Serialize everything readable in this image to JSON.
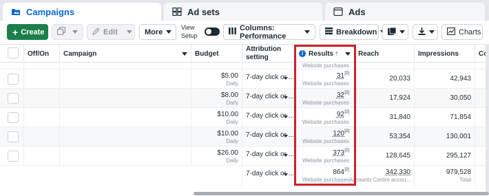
{
  "tabs": [
    {
      "label": "Campaigns",
      "icon": "folder-icon"
    },
    {
      "label": "Ad sets",
      "icon": "grid-icon"
    },
    {
      "label": "Ads",
      "icon": "ad-icon"
    }
  ],
  "toolbar": {
    "create": "Create",
    "edit": "Edit",
    "more": "More",
    "view_setup": "View Setup",
    "columns": "Columns: Performance",
    "breakdown": "Breakdown",
    "charts": "Charts"
  },
  "headers": {
    "off_on": "Off/On",
    "campaign": "Campaign",
    "budget": "Budget",
    "attribution": "Attribution setting",
    "results": "Results",
    "reach": "Reach",
    "impressions": "Impressions",
    "cost": "Co"
  },
  "rows": [
    {
      "budget": "$5.00",
      "period": "Daily",
      "attribution": "7-day click or ...",
      "results": "31",
      "results_sub": "Website purchases",
      "reach": "20,033",
      "impressions": "42,943"
    },
    {
      "budget": "$8.00",
      "period": "Daily",
      "attribution": "7-day click or ...",
      "results": "32",
      "results_sub": "Website purchases",
      "reach": "17,924",
      "impressions": "30,050"
    },
    {
      "budget": "$10.00",
      "period": "Daily",
      "attribution": "7-day click or ...",
      "results": "92",
      "results_sub": "Website purchases",
      "reach": "31,840",
      "impressions": "71,854"
    },
    {
      "budget": "$10.00",
      "period": "Daily",
      "attribution": "7-day click or ...",
      "results": "120",
      "results_sub": "Website purchases",
      "reach": "53,354",
      "impressions": "130,001"
    },
    {
      "budget": "$26.00",
      "period": "Daily",
      "attribution": "7-day click or ...",
      "results": "373",
      "results_sub": "Website purchases",
      "reach": "128,645",
      "impressions": "295,127"
    }
  ],
  "partial_row": {
    "results_sub": "Website purchases"
  },
  "total": {
    "attribution": "7-day click or ...",
    "results": "864",
    "results_sub": "Website purchases",
    "reach": "342,330",
    "reach_sub": "Accounts Centre accou...",
    "impressions": "979,528",
    "impressions_sub": "Total"
  },
  "footnote_marker": "[2]",
  "colors": {
    "accent": "#0a66d8",
    "create": "#1b7f4b",
    "highlight": "#d0202a"
  }
}
